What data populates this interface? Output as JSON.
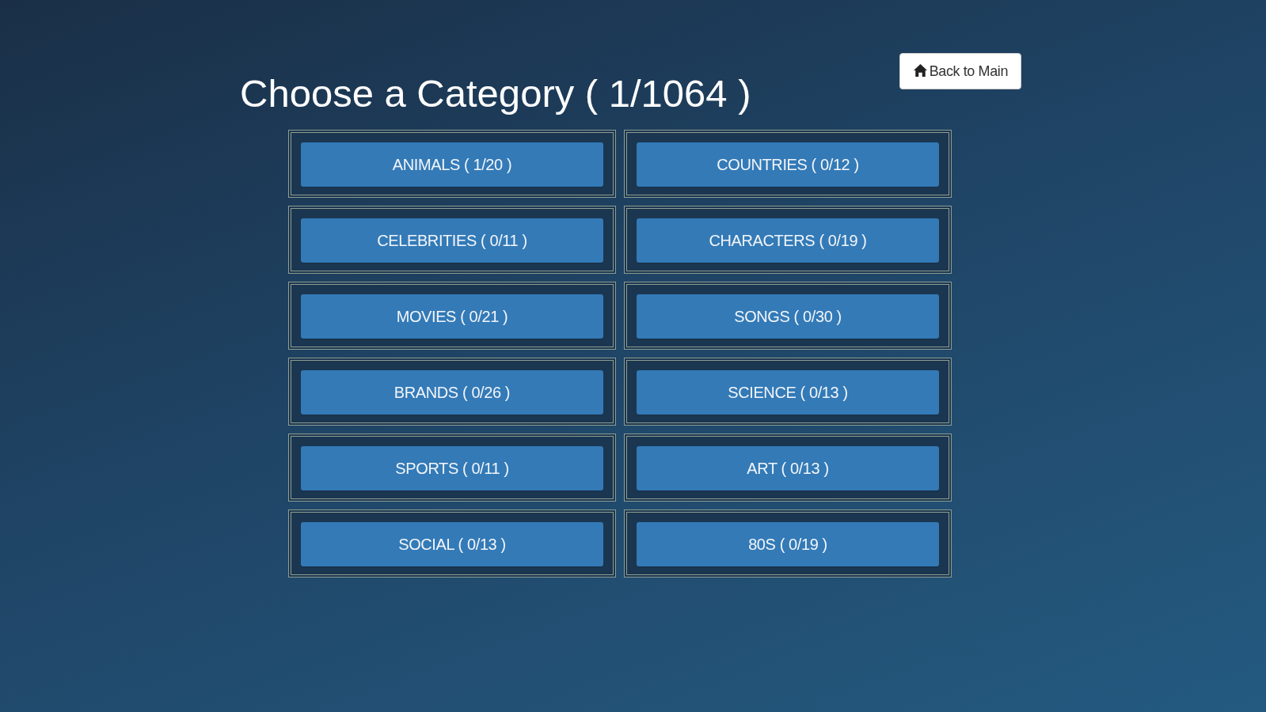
{
  "back_button": {
    "label": "Back to Main"
  },
  "title": "Choose a Category ( 1/1064 )",
  "categories": [
    {
      "label": "ANIMALS ( 1/20 )"
    },
    {
      "label": "COUNTRIES ( 0/12 )"
    },
    {
      "label": "CELEBRITIES ( 0/11 )"
    },
    {
      "label": "CHARACTERS ( 0/19 )"
    },
    {
      "label": "MOVIES ( 0/21 )"
    },
    {
      "label": "SONGS ( 0/30 )"
    },
    {
      "label": "BRANDS ( 0/26 )"
    },
    {
      "label": "SCIENCE ( 0/13 )"
    },
    {
      "label": "SPORTS ( 0/11 )"
    },
    {
      "label": "ART ( 0/13 )"
    },
    {
      "label": "SOCIAL ( 0/13 )"
    },
    {
      "label": "80S ( 0/19 )"
    }
  ]
}
